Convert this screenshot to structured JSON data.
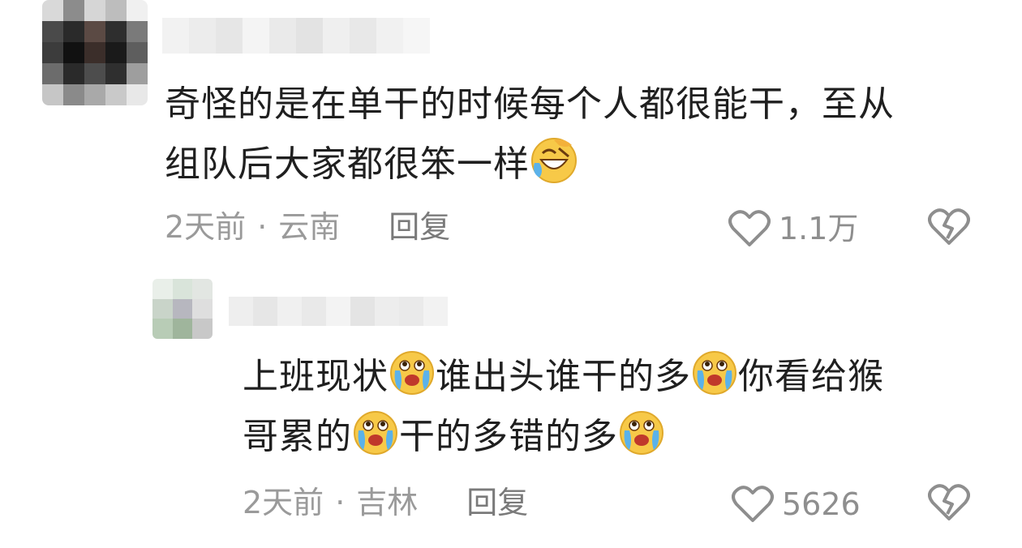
{
  "comments": [
    {
      "text_line1": "奇怪的是在单干的时候每个人都很能干，至从",
      "text_line2": "组队后大家都很笨一样",
      "emoji": "laughing-tears-emoji",
      "time": "2天前",
      "separator": "·",
      "location": "云南",
      "reply_label": "回复",
      "likes": "1.1万"
    },
    {
      "text_line1_a": "上班现状",
      "text_line1_b": "谁出头谁干的多",
      "text_line1_c": "你看给猴",
      "text_line2_a": "哥累的",
      "text_line2_b": "干的多错的多",
      "emoji": "crying-face-emoji",
      "time": "2天前",
      "separator": "·",
      "location": "吉林",
      "reply_label": "回复",
      "likes": "5626"
    }
  ],
  "icons": {
    "like": "heart-outline-icon",
    "dislike": "broken-heart-icon"
  },
  "colors": {
    "text": "#1f1f1f",
    "meta": "#9a9a9a",
    "emoji_yellow": "#f7c948"
  }
}
